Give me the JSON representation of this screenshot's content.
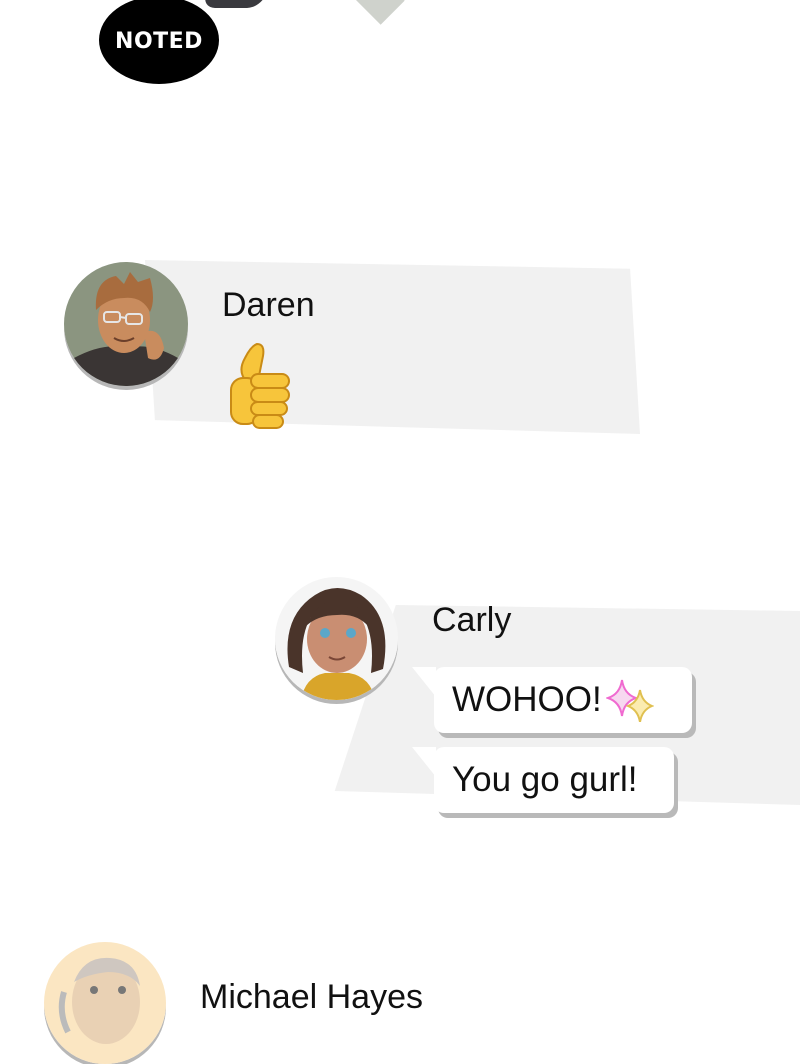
{
  "top": {
    "badge_text": "NOTED"
  },
  "messages": [
    {
      "sender": "Daren",
      "avatar_icon": "daren-avatar",
      "content_icon": "thumbs-up-emoji"
    },
    {
      "sender": "Carly",
      "avatar_icon": "carly-avatar",
      "bubbles": [
        {
          "text": "WOHOO!",
          "emoji": "sparkles-emoji"
        },
        {
          "text": "You go gurl!"
        }
      ]
    },
    {
      "sender": "Michael Hayes",
      "avatar_icon": "michael-avatar"
    }
  ],
  "colors": {
    "panel": "#f1f1f1",
    "badge": "#000000",
    "bubble_shadow": "#b9b9b9",
    "thumbs_yellow": "#f7c53b",
    "sparkle_pink": "#f06ad0",
    "sparkle_yellow": "#f8e27a"
  }
}
